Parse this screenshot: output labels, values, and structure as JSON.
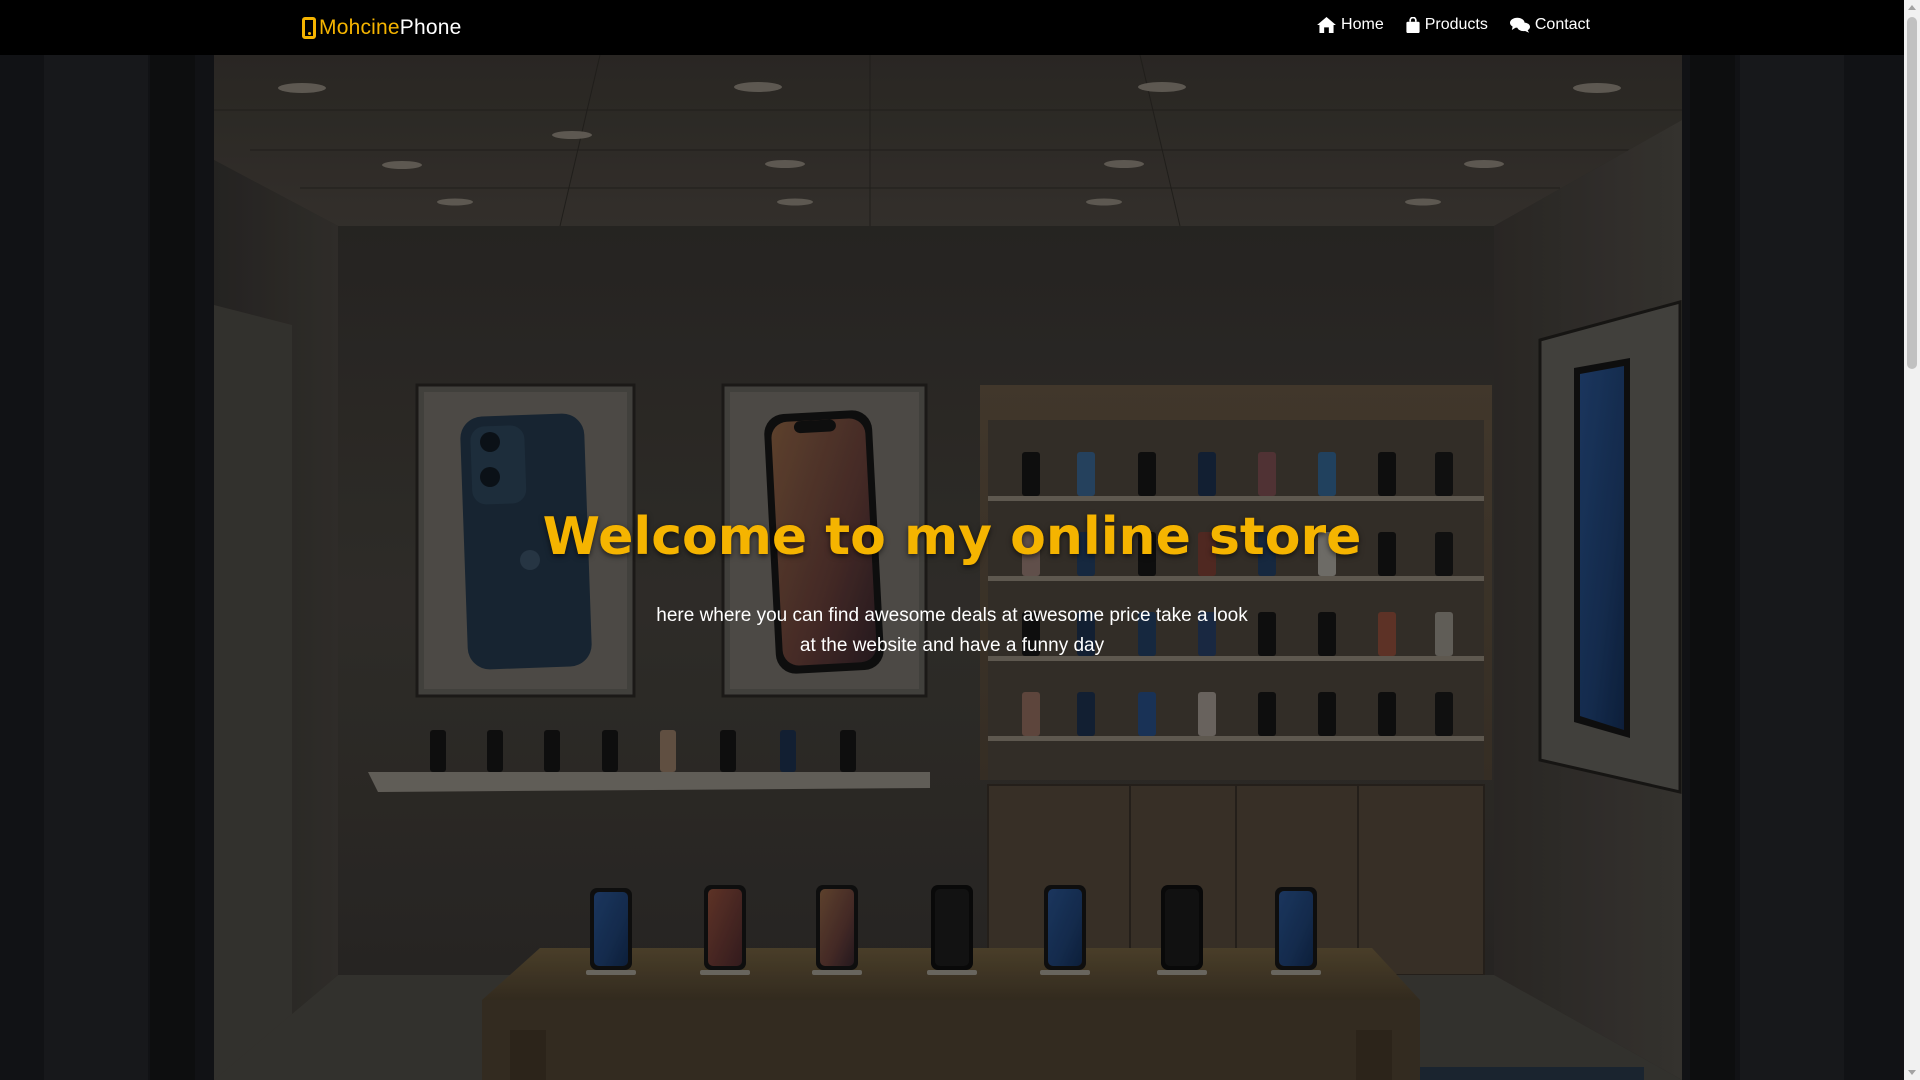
{
  "brand": {
    "part1": "Mohcine",
    "part2": "Phone",
    "icon": "mobile-phone-icon",
    "accent_color": "#f5b400"
  },
  "nav": {
    "items": [
      {
        "label": "Home",
        "icon": "home-icon"
      },
      {
        "label": "Products",
        "icon": "shopping-bag-icon"
      },
      {
        "label": "Contact",
        "icon": "chat-bubbles-icon"
      }
    ]
  },
  "hero": {
    "title": "Welcome to my online store",
    "subtitle": "here where you can find awesome deals at awesome price take a look at the website and have a funny day",
    "title_color": "#f5b400",
    "subtitle_color": "#ffffff",
    "background": "dark phone store interior with phone posters, shelves and display table"
  }
}
